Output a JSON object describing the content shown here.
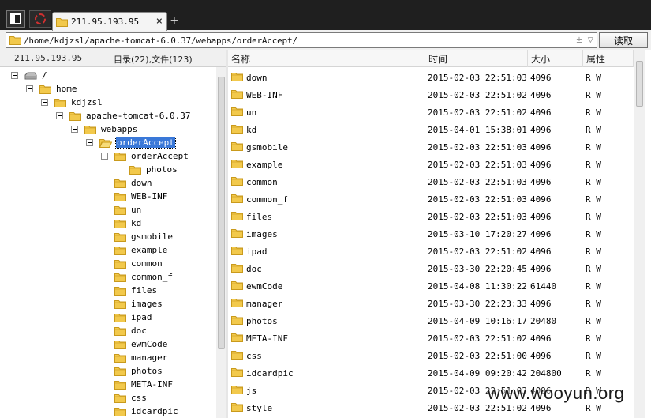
{
  "tab": {
    "title": "211.95.193.95",
    "close": "×",
    "new_tab": "+"
  },
  "address": {
    "path": "/home/kdjzsl/apache-tomcat-6.0.37/webapps/orderAccept/",
    "controls": "± ▽",
    "read_button": "读取"
  },
  "left_header": {
    "host": "211.95.193.95",
    "counts": "目录(22),文件(123)"
  },
  "tree": [
    {
      "label": "/",
      "level": 0,
      "icon": "drive",
      "expanded": true
    },
    {
      "label": "home",
      "level": 1,
      "icon": "folder",
      "expanded": true
    },
    {
      "label": "kdjzsl",
      "level": 2,
      "icon": "folder",
      "expanded": true
    },
    {
      "label": "apache-tomcat-6.0.37",
      "level": 3,
      "icon": "folder",
      "expanded": true
    },
    {
      "label": "webapps",
      "level": 4,
      "icon": "folder",
      "expanded": true
    },
    {
      "label": "orderAccept",
      "level": 5,
      "icon": "folder-open",
      "expanded": true,
      "selected": true
    },
    {
      "label": "orderAccept",
      "level": 6,
      "icon": "folder",
      "expanded": true
    },
    {
      "label": "photos",
      "level": 7,
      "icon": "folder"
    },
    {
      "label": "down",
      "level": 6,
      "icon": "folder"
    },
    {
      "label": "WEB-INF",
      "level": 6,
      "icon": "folder"
    },
    {
      "label": "un",
      "level": 6,
      "icon": "folder"
    },
    {
      "label": "kd",
      "level": 6,
      "icon": "folder"
    },
    {
      "label": "gsmobile",
      "level": 6,
      "icon": "folder"
    },
    {
      "label": "example",
      "level": 6,
      "icon": "folder"
    },
    {
      "label": "common",
      "level": 6,
      "icon": "folder"
    },
    {
      "label": "common_f",
      "level": 6,
      "icon": "folder"
    },
    {
      "label": "files",
      "level": 6,
      "icon": "folder"
    },
    {
      "label": "images",
      "level": 6,
      "icon": "folder"
    },
    {
      "label": "ipad",
      "level": 6,
      "icon": "folder"
    },
    {
      "label": "doc",
      "level": 6,
      "icon": "folder"
    },
    {
      "label": "ewmCode",
      "level": 6,
      "icon": "folder"
    },
    {
      "label": "manager",
      "level": 6,
      "icon": "folder"
    },
    {
      "label": "photos",
      "level": 6,
      "icon": "folder"
    },
    {
      "label": "META-INF",
      "level": 6,
      "icon": "folder"
    },
    {
      "label": "css",
      "level": 6,
      "icon": "folder"
    },
    {
      "label": "idcardpic",
      "level": 6,
      "icon": "folder"
    }
  ],
  "list_columns": {
    "name": "名称",
    "time": "时间",
    "size": "大小",
    "attr": "属性"
  },
  "files": [
    {
      "name": "down",
      "time": "2015-02-03 22:51:03",
      "size": "4096",
      "attr": "R W"
    },
    {
      "name": "WEB-INF",
      "time": "2015-02-03 22:51:02",
      "size": "4096",
      "attr": "R W"
    },
    {
      "name": "un",
      "time": "2015-02-03 22:51:02",
      "size": "4096",
      "attr": "R W"
    },
    {
      "name": "kd",
      "time": "2015-04-01 15:38:01",
      "size": "4096",
      "attr": "R W"
    },
    {
      "name": "gsmobile",
      "time": "2015-02-03 22:51:03",
      "size": "4096",
      "attr": "R W"
    },
    {
      "name": "example",
      "time": "2015-02-03 22:51:03",
      "size": "4096",
      "attr": "R W"
    },
    {
      "name": "common",
      "time": "2015-02-03 22:51:03",
      "size": "4096",
      "attr": "R W"
    },
    {
      "name": "common_f",
      "time": "2015-02-03 22:51:03",
      "size": "4096",
      "attr": "R W"
    },
    {
      "name": "files",
      "time": "2015-02-03 22:51:03",
      "size": "4096",
      "attr": "R W"
    },
    {
      "name": "images",
      "time": "2015-03-10 17:20:27",
      "size": "4096",
      "attr": "R W"
    },
    {
      "name": "ipad",
      "time": "2015-02-03 22:51:02",
      "size": "4096",
      "attr": "R W"
    },
    {
      "name": "doc",
      "time": "2015-03-30 22:20:45",
      "size": "4096",
      "attr": "R W"
    },
    {
      "name": "ewmCode",
      "time": "2015-04-08 11:30:22",
      "size": "61440",
      "attr": "R W"
    },
    {
      "name": "manager",
      "time": "2015-03-30 22:23:33",
      "size": "4096",
      "attr": "R W"
    },
    {
      "name": "photos",
      "time": "2015-04-09 10:16:17",
      "size": "20480",
      "attr": "R W"
    },
    {
      "name": "META-INF",
      "time": "2015-02-03 22:51:02",
      "size": "4096",
      "attr": "R W"
    },
    {
      "name": "css",
      "time": "2015-02-03 22:51:00",
      "size": "4096",
      "attr": "R W"
    },
    {
      "name": "idcardpic",
      "time": "2015-04-09 09:20:42",
      "size": "204800",
      "attr": "R W"
    },
    {
      "name": "js",
      "time": "2015-02-03 22:51:03",
      "size": "4096",
      "attr": "R W"
    },
    {
      "name": "style",
      "time": "2015-02-03 22:51:02",
      "size": "4096",
      "attr": "R W"
    }
  ],
  "watermark": "www.wooyun.org",
  "colors": {
    "tabbar": "#1f1f1f",
    "selection": "#3a78d8",
    "folder": "#f2c94c",
    "folder_edge": "#c99a1c"
  }
}
